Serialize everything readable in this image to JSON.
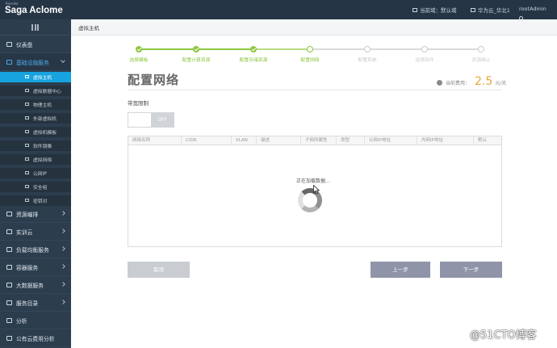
{
  "app": {
    "brand": "Saga Aclome",
    "brand_small": "Reseller"
  },
  "topbar": {
    "current_domain_label": "当前域：",
    "current_domain_value": "默认域",
    "region": "华为云_华北1",
    "user": "rootAdmin"
  },
  "sidebar": {
    "items": [
      {
        "label": "仪表盘",
        "icon": "dashboard-icon"
      },
      {
        "label": "基础设施服务",
        "icon": "box-icon",
        "expanded": true
      },
      {
        "label": "资源编排",
        "icon": "diamond-icon"
      },
      {
        "label": "实训云",
        "icon": "cloud-icon"
      },
      {
        "label": "负载均衡服务",
        "icon": "balance-icon"
      },
      {
        "label": "容器服务",
        "icon": "container-icon"
      },
      {
        "label": "大数据服务",
        "icon": "bigdata-icon"
      },
      {
        "label": "服务目录",
        "icon": "catalog-icon"
      },
      {
        "label": "分析",
        "icon": "chart-icon"
      },
      {
        "label": "公有云费用分析",
        "icon": "cloud-icon"
      }
    ],
    "subitems": [
      {
        "label": "虚拟主机",
        "active": true
      },
      {
        "label": "虚拟数据中心"
      },
      {
        "label": "物理主机"
      },
      {
        "label": "外部虚拟机"
      },
      {
        "label": "虚拟机模板"
      },
      {
        "label": "软件镜像"
      },
      {
        "label": "虚拟网络"
      },
      {
        "label": "公网IP"
      },
      {
        "label": "安全组"
      },
      {
        "label": "密钥对"
      }
    ]
  },
  "breadcrumb": "虚拟主机",
  "steps": [
    {
      "label": "选择模板",
      "state": "done"
    },
    {
      "label": "配置计算资源",
      "state": "done"
    },
    {
      "label": "配置存储资源",
      "state": "done"
    },
    {
      "label": "配置网络",
      "state": "current"
    },
    {
      "label": "配置系统",
      "state": "todo"
    },
    {
      "label": "选择软件",
      "state": "todo"
    },
    {
      "label": "资源确认",
      "state": "todo"
    }
  ],
  "colors": {
    "done": "#8dc63f",
    "todo": "#c8ccd0",
    "accent": "#17a3e0",
    "price": "#e8a53d"
  },
  "page": {
    "title": "配置网络",
    "price_label": "当前费用：",
    "price_value": "2.5",
    "price_unit": "元/天",
    "bandwidth_label": "带宽限制",
    "toggle_off": "OFF"
  },
  "table": {
    "headers": [
      "网络名称",
      "CIDR",
      "VLAN",
      "描述",
      "子网所属性",
      "类型",
      "公网IP地址",
      "内网IP地址",
      "默认"
    ],
    "loading_text": "正在加载数据..."
  },
  "buttons": {
    "cancel": "取消",
    "prev": "上一步",
    "next": "下一步"
  },
  "watermark": "@51CTO博客"
}
